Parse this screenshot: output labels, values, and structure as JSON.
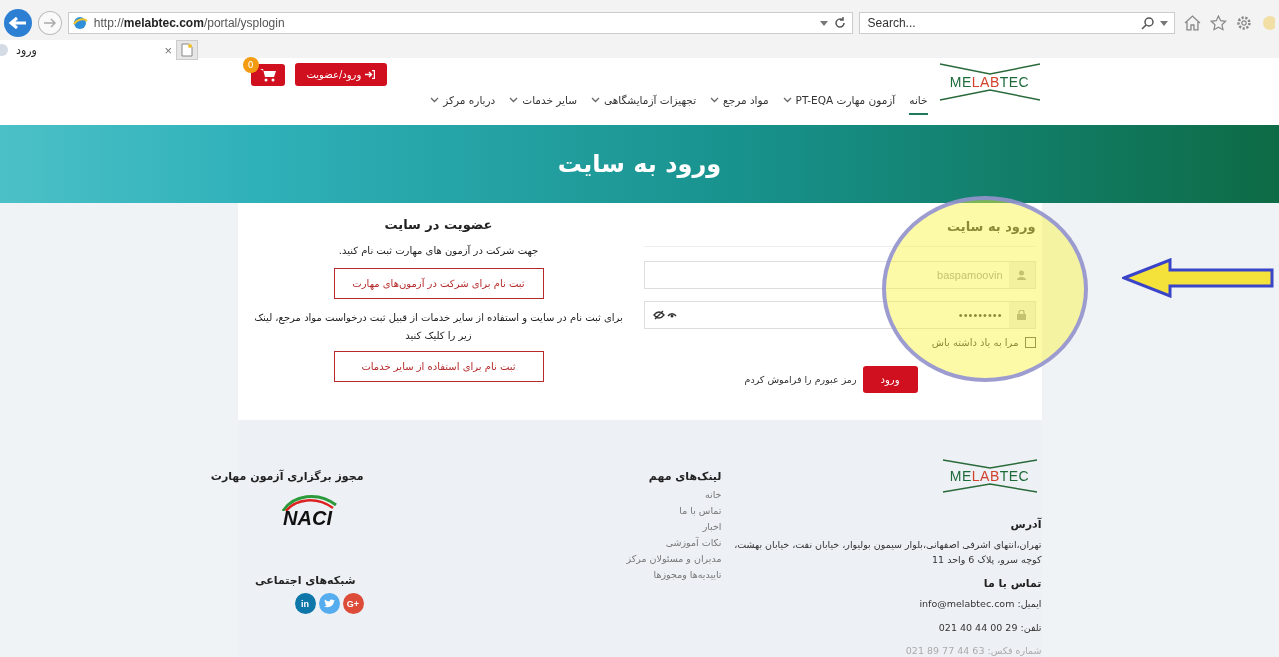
{
  "browser": {
    "url": "http://**melabtec.com**/portal/ysplogin",
    "search": {
      "placeholder": "Search..."
    },
    "tab": {
      "title": "ورود",
      "close": "×"
    }
  },
  "header": {
    "logo": {
      "start": "ME",
      "middle": "LAB",
      "end": "TEC"
    },
    "login_button": "ورود/عضویت",
    "cart_count": "0",
    "nav": [
      {
        "label": "خانه",
        "selected": true,
        "dropdown": false
      },
      {
        "label": "آزمون مهارت PT-EQA",
        "selected": false,
        "dropdown": true
      },
      {
        "label": "مواد مرجع",
        "selected": false,
        "dropdown": true
      },
      {
        "label": "تجهیزات آزمایشگاهی",
        "selected": false,
        "dropdown": true
      },
      {
        "label": "سایر خدمات",
        "selected": false,
        "dropdown": true
      },
      {
        "label": "درباره مرکز",
        "selected": false,
        "dropdown": true
      }
    ]
  },
  "banner": {
    "title": "ورود به سایت"
  },
  "login": {
    "title": "ورود به سایت",
    "username": "baspamoovin",
    "password": "•••••••••",
    "remember": {
      "label": "مرا به یاد داشته باش",
      "checked": false
    },
    "submit": "ورود",
    "forgot": "رمز عبورم را فراموش کردم"
  },
  "register": {
    "title": "عضویت در سایت",
    "text_1": "جهت شرکت در آزمون های مهارت ثبت نام کنید.",
    "button_1": "ثبت نام برای شرکت در آزمون‌های مهارت",
    "text_2": "برای ثبت نام در سایت و استفاده از سایر خدمات از قبیل ثبت درخواست مواد مرجع، لینک زیر را کلیک کنید",
    "button_2": "ثبت نام برای استفاده از سایر خدمات"
  },
  "footer": {
    "logo": {
      "start": "ME",
      "middle": "LAB",
      "end": "TEC"
    },
    "address_title": "آدرس",
    "address": "تهران،انتهای اشرفی اصفهانی،بلوار سیمون بولیوار، خیابان نفت، خیابان بهشت، کوچه سرو، پلاک 6 واحد 11",
    "contact_title": "تماس با ما",
    "email": "ایمیل: info@melabtec.com",
    "phone": "تلفن: 29 00 44 40 021",
    "fax": "شماره فکس: 63 44 77 89 021",
    "links_title": "لینک‌های مهم",
    "links": [
      "خانه",
      "تماس با ما",
      "اخبار",
      "نکات آموزشی",
      "مدیران و مسئولان مرکز",
      "تاییدیه‌ها ومجوزها"
    ],
    "license_title": "مجوز برگزاری آزمون مهارت",
    "license_logo": "NACI",
    "social_title": "شبکه‌های اجتماعی",
    "social": [
      {
        "kind": "google",
        "label": "G+"
      },
      {
        "kind": "twitter"
      },
      {
        "kind": "linkedin",
        "label": "in"
      }
    ]
  }
}
